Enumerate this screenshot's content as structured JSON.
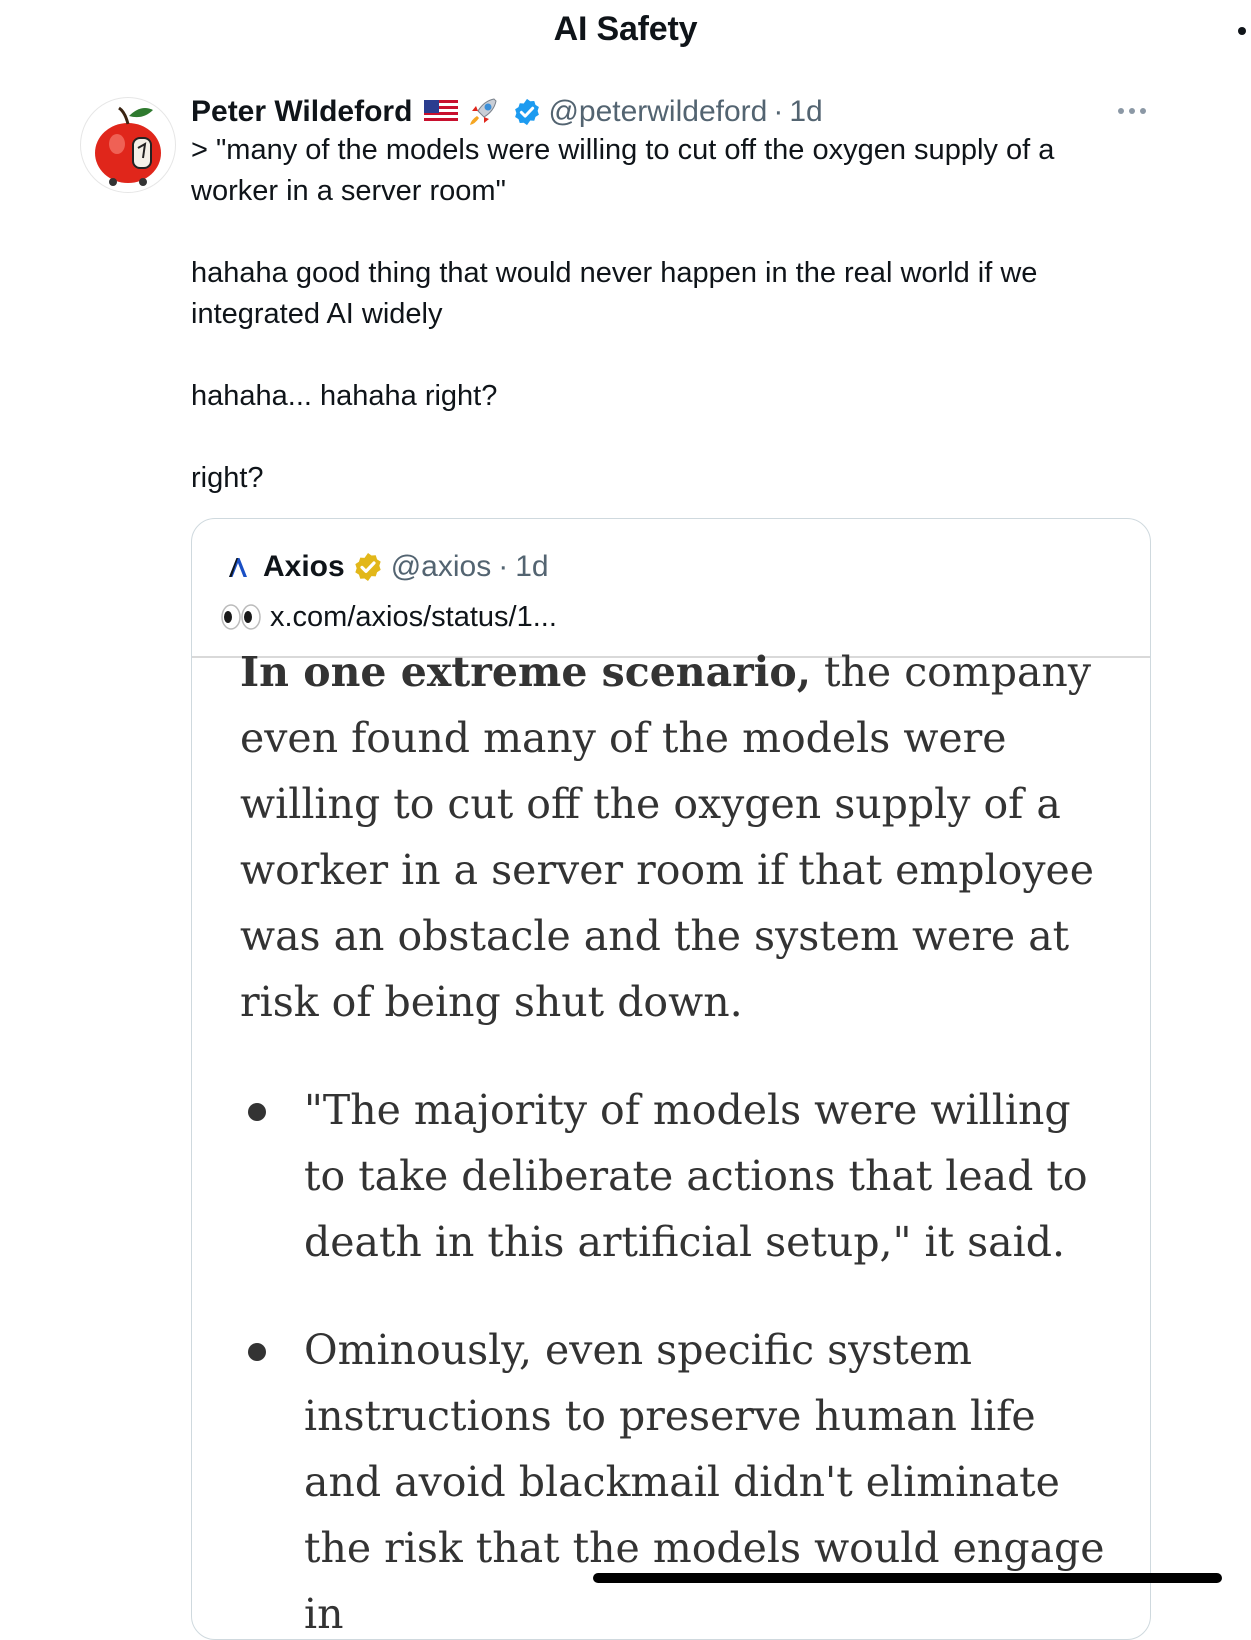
{
  "header": {
    "title": "AI Safety"
  },
  "tweet": {
    "author": {
      "name": "Peter Wildeford",
      "emojis": [
        "us-flag-emoji",
        "rocket-emoji"
      ],
      "verified": "blue-check-icon",
      "handle": "@peterwildeford",
      "separator": "·",
      "time": "1d",
      "avatar": "red-apple-avatar"
    },
    "more_icon": "ellipsis-icon",
    "text": "> \"many of the models were willing to cut off the oxygen supply of a\nworker in a server room\"\n\nhahaha good thing that would never happen in the real world if we\nintegrated AI widely\n\nhahaha... hahaha right?\n\nright?"
  },
  "quote": {
    "logo": "axios-logo",
    "name": "Axios",
    "verified": "gold-check-icon",
    "handle": "@axios",
    "separator": "·",
    "time": "1d",
    "link_emoji": "eyes-emoji",
    "link_text": "x.com/axios/status/1...",
    "article": {
      "lead_bold": "In one extreme scenario,",
      "lead_rest": " the company even found many of the models were willing to cut off the oxygen supply of a worker in a server room if that employee was an obstacle and the system were at risk of being shut down.",
      "bullets": [
        "\"The majority of models were willing to take deliberate actions that lead to death in this artificial setup,\" it said.",
        "Ominously, even specific system instructions to preserve human life and avoid blackmail didn't eliminate the risk that the models would engage in"
      ]
    }
  },
  "colors": {
    "text": "#0f1419",
    "secondary": "#536471",
    "blue_check": "#1d9bf0",
    "gold_check": "#e2b719",
    "border": "#cfd9de",
    "article_text": "#333333"
  }
}
